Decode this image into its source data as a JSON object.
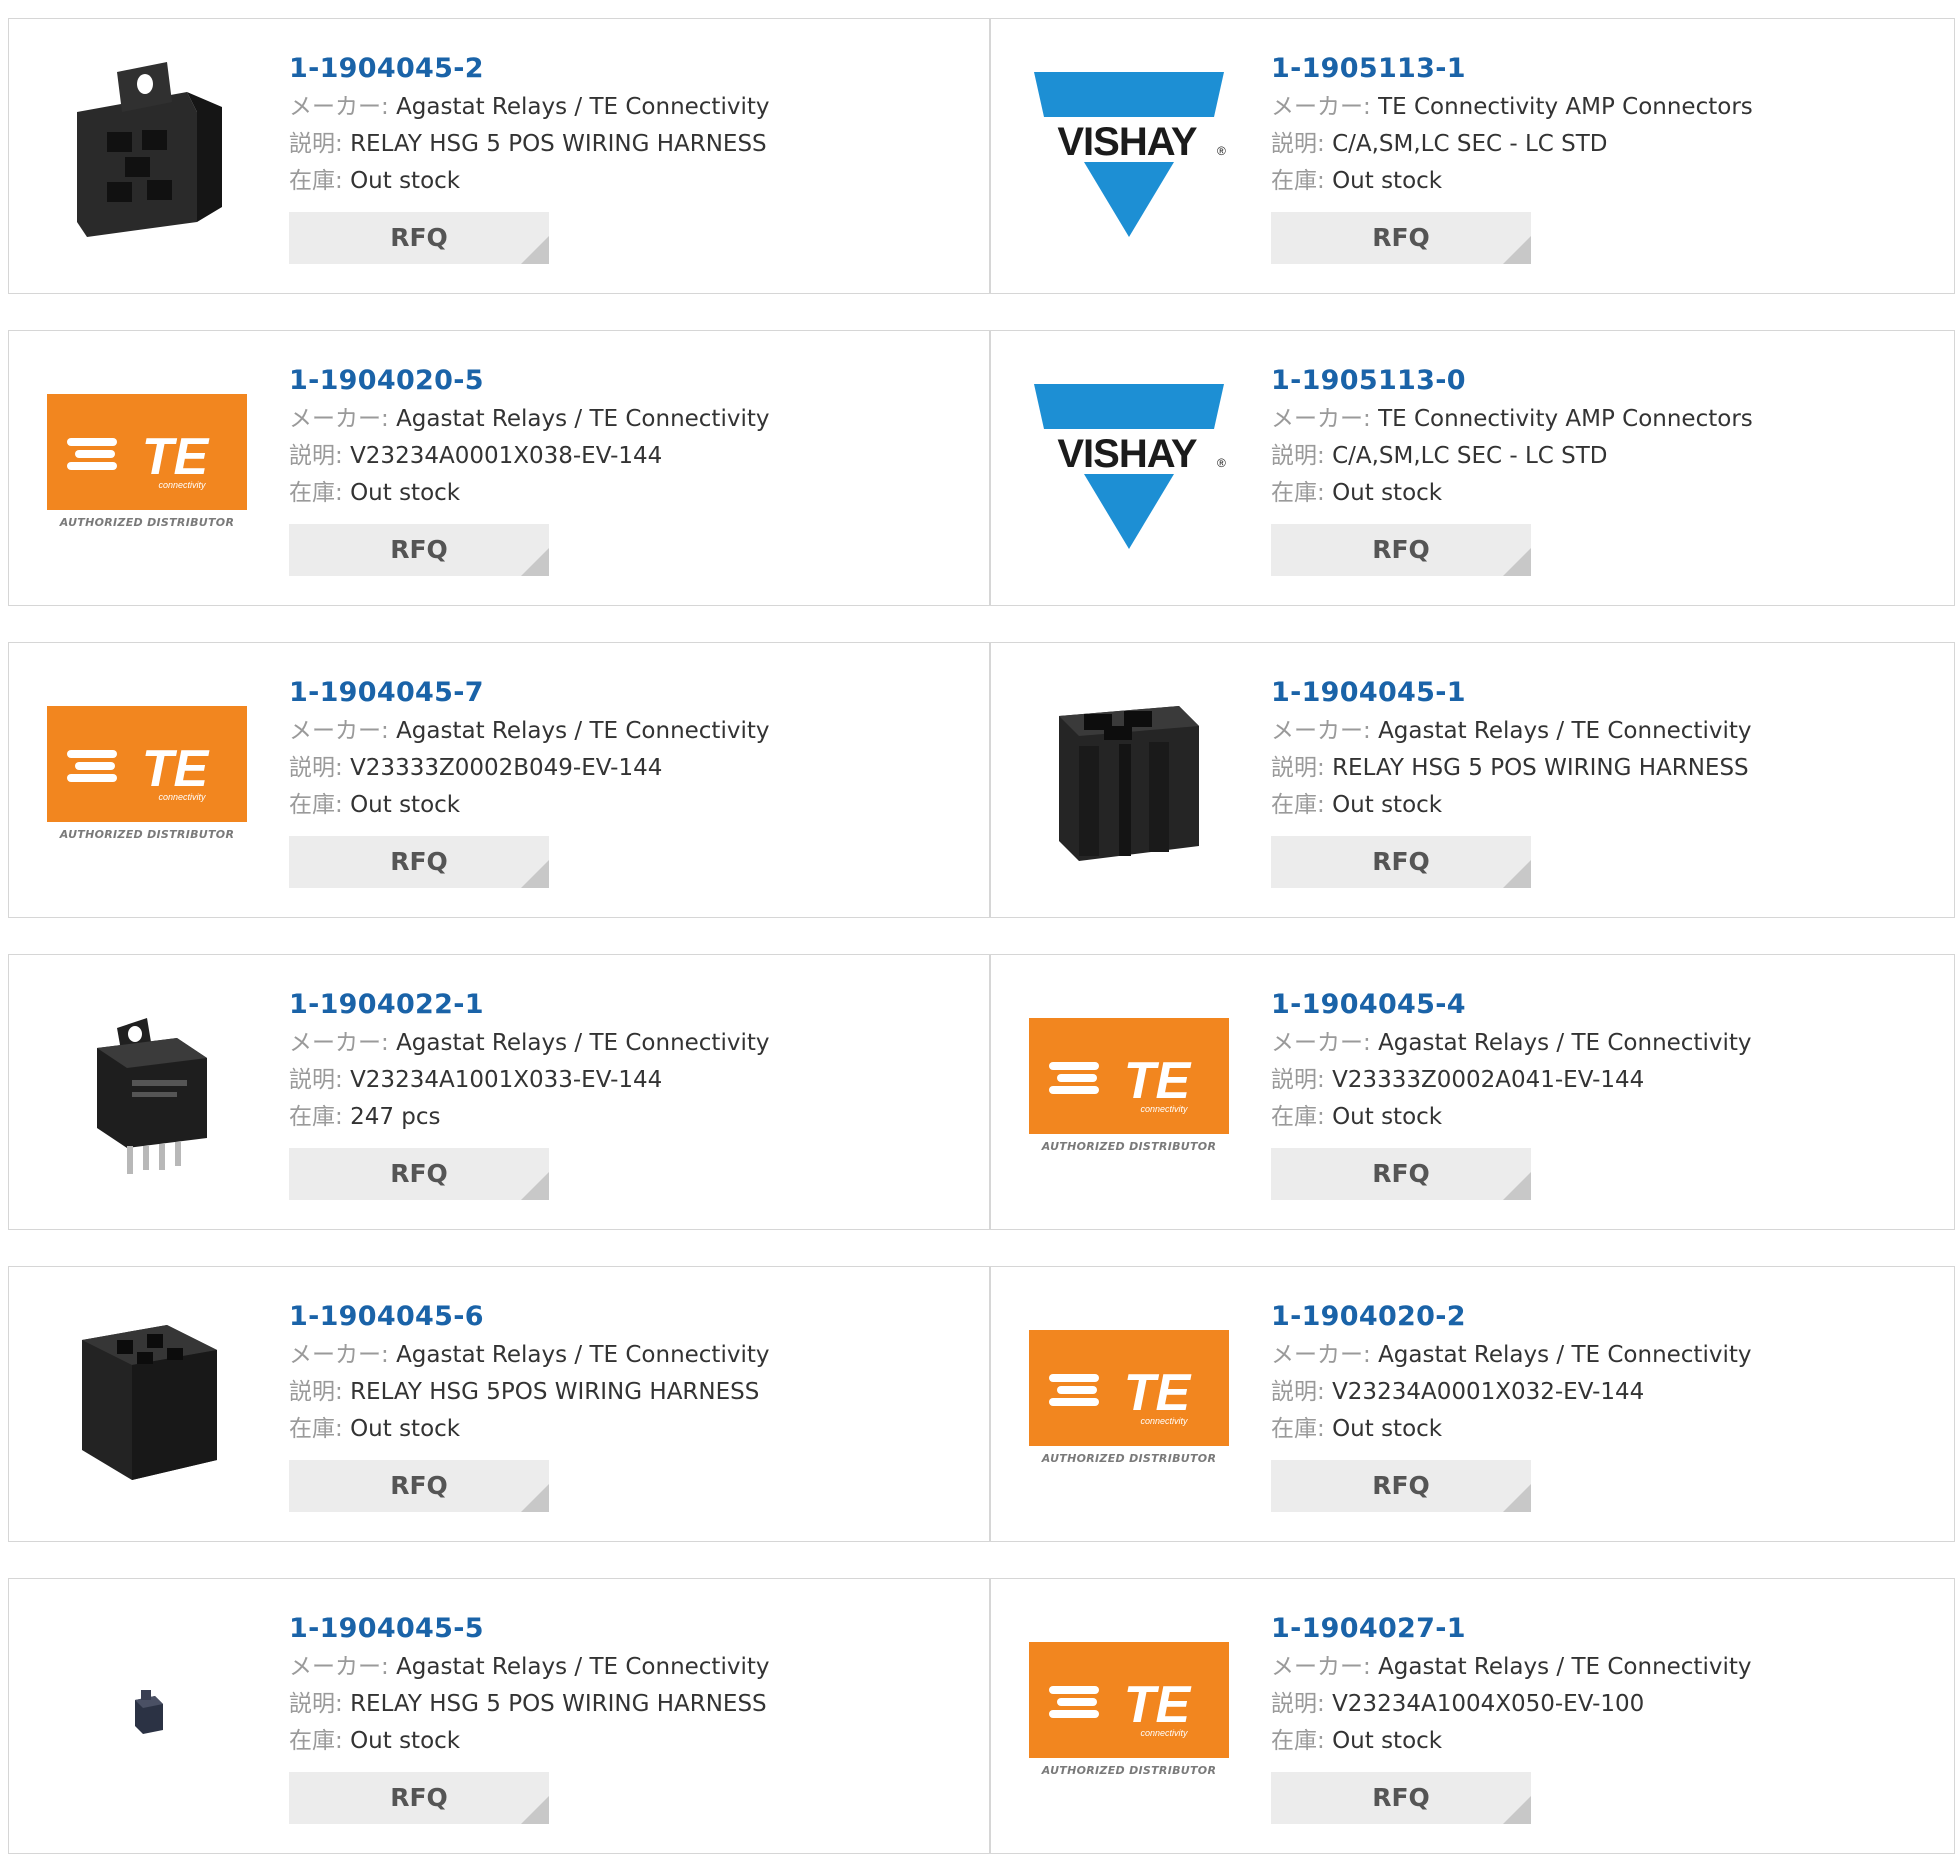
{
  "labels": {
    "maker": "メーカー:",
    "description": "説明:",
    "stock": "在庫:",
    "rfq": "RFQ"
  },
  "logos": {
    "te": {
      "text": "TE",
      "subtext": "connectivity",
      "caption": "AUTHORIZED DISTRIBUTOR",
      "color": "#f2861f"
    },
    "vishay": {
      "text": "VISHAY",
      "registered": "®",
      "color": "#1d8fd4"
    }
  },
  "products": [
    {
      "part": "1-1904045-2",
      "maker": "Agastat Relays / TE Connectivity",
      "desc": "RELAY HSG 5 POS WIRING HARNESS",
      "stock": "Out stock",
      "image": "relay-housing-bracket-icon"
    },
    {
      "part": "1-1905113-1",
      "maker": "TE Connectivity AMP Connectors",
      "desc": "C/A,SM,LC SEC - LC STD",
      "stock": "Out stock",
      "image": "vishay-logo"
    },
    {
      "part": "1-1904020-5",
      "maker": "Agastat Relays / TE Connectivity",
      "desc": "V23234A0001X038-EV-144",
      "stock": "Out stock",
      "image": "te-logo"
    },
    {
      "part": "1-1905113-0",
      "maker": "TE Connectivity AMP Connectors",
      "desc": "C/A,SM,LC SEC - LC STD",
      "stock": "Out stock",
      "image": "vishay-logo"
    },
    {
      "part": "1-1904045-7",
      "maker": "Agastat Relays / TE Connectivity",
      "desc": "V23333Z0002B049-EV-144",
      "stock": "Out stock",
      "image": "te-logo"
    },
    {
      "part": "1-1904045-1",
      "maker": "Agastat Relays / TE Connectivity",
      "desc": "RELAY HSG 5 POS WIRING HARNESS",
      "stock": "Out stock",
      "image": "relay-housing-socket-icon"
    },
    {
      "part": "1-1904022-1",
      "maker": "Agastat Relays / TE Connectivity",
      "desc": "V23234A1001X033-EV-144",
      "stock": "247 pcs",
      "image": "relay-cube-icon"
    },
    {
      "part": "1-1904045-4",
      "maker": "Agastat Relays / TE Connectivity",
      "desc": "V23333Z0002A041-EV-144",
      "stock": "Out stock",
      "image": "te-logo"
    },
    {
      "part": "1-1904045-6",
      "maker": "Agastat Relays / TE Connectivity",
      "desc": "RELAY HSG 5POS WIRING HARNESS",
      "stock": "Out stock",
      "image": "relay-housing-block-icon"
    },
    {
      "part": "1-1904020-2",
      "maker": "Agastat Relays / TE Connectivity",
      "desc": "V23234A0001X032-EV-144",
      "stock": "Out stock",
      "image": "te-logo"
    },
    {
      "part": "1-1904045-5",
      "maker": "Agastat Relays / TE Connectivity",
      "desc": "RELAY HSG 5 POS WIRING HARNESS",
      "stock": "Out stock",
      "image": "relay-housing-small-icon"
    },
    {
      "part": "1-1904027-1",
      "maker": "Agastat Relays / TE Connectivity",
      "desc": "V23234A1004X050-EV-100",
      "stock": "Out stock",
      "image": "te-logo"
    }
  ]
}
